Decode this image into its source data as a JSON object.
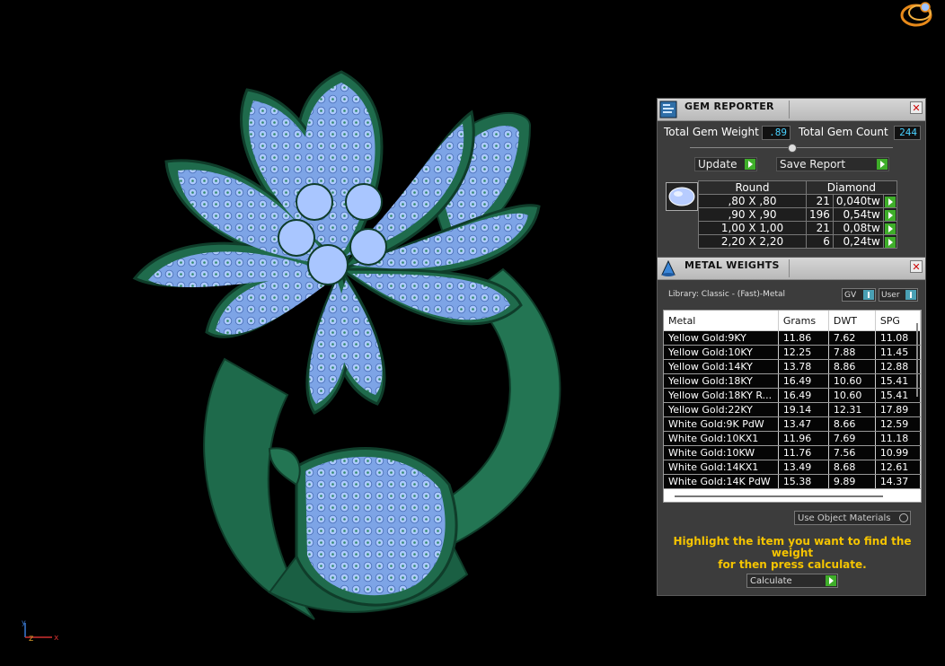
{
  "viewport": {
    "axis_labels": {
      "y": "y",
      "z": "z",
      "x": "x"
    }
  },
  "gem_reporter": {
    "title": "GEM REPORTER",
    "total_weight_label": "Total Gem Weight",
    "total_weight_value": ".89",
    "total_count_label": "Total Gem Count",
    "total_count_value": "244",
    "update_label": "Update",
    "save_report_label": "Save Report",
    "columns": [
      "Round",
      "Diamond"
    ],
    "rows": [
      {
        "size": ",80 X ,80",
        "count": "21",
        "weight": "0,040tw"
      },
      {
        "size": ",90 X ,90",
        "count": "196",
        "weight": "0,54tw"
      },
      {
        "size": "1,00 X 1,00",
        "count": "21",
        "weight": "0,08tw"
      },
      {
        "size": "2,20 X 2,20",
        "count": "6",
        "weight": "0,24tw"
      }
    ]
  },
  "metal_weights": {
    "title": "METAL WEIGHTS",
    "library": "Library: Classic - (Fast)-Metal",
    "gv_label": "GV",
    "user_label": "User",
    "columns": [
      "Metal",
      "Grams",
      "DWT",
      "SPG"
    ],
    "rows": [
      {
        "metal": "Yellow Gold:9KY",
        "grams": "11.86",
        "dwt": "7.62",
        "spg": "11.08"
      },
      {
        "metal": "Yellow Gold:10KY",
        "grams": "12.25",
        "dwt": "7.88",
        "spg": "11.45"
      },
      {
        "metal": "Yellow Gold:14KY",
        "grams": "13.78",
        "dwt": "8.86",
        "spg": "12.88"
      },
      {
        "metal": "Yellow Gold:18KY",
        "grams": "16.49",
        "dwt": "10.60",
        "spg": "15.41"
      },
      {
        "metal": "Yellow Gold:18KY R...",
        "grams": "16.49",
        "dwt": "10.60",
        "spg": "15.41"
      },
      {
        "metal": "Yellow Gold:22KY",
        "grams": "19.14",
        "dwt": "12.31",
        "spg": "17.89"
      },
      {
        "metal": "White Gold:9K PdW",
        "grams": "13.47",
        "dwt": "8.66",
        "spg": "12.59"
      },
      {
        "metal": "White Gold:10KX1",
        "grams": "11.96",
        "dwt": "7.69",
        "spg": "11.18"
      },
      {
        "metal": "White Gold:10KW",
        "grams": "11.76",
        "dwt": "7.56",
        "spg": "10.99"
      },
      {
        "metal": "White Gold:14KX1",
        "grams": "13.49",
        "dwt": "8.68",
        "spg": "12.61"
      },
      {
        "metal": "White Gold:14K PdW",
        "grams": "15.38",
        "dwt": "9.89",
        "spg": "14.37"
      }
    ],
    "use_object_materials": "Use Object Materials",
    "hint_line1": "Highlight the item you want to find the weight",
    "hint_line2": "for then press calculate.",
    "calculate_label": "Calculate"
  },
  "colors": {
    "accent_green": "#3fae2a",
    "hint_yellow": "#f5c400",
    "value_cyan": "#49d1ff",
    "metal": "#1f6b4c",
    "gem": "#8fb6f0"
  }
}
